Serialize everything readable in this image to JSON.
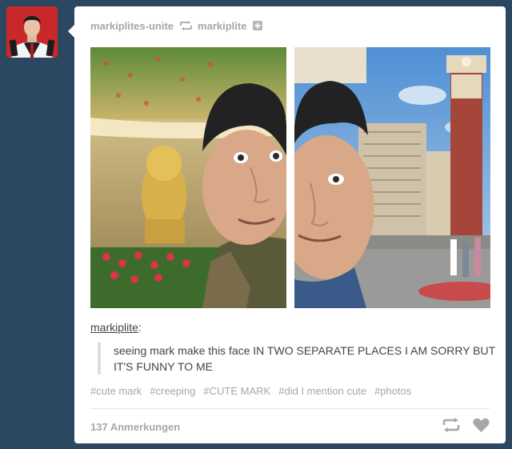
{
  "post": {
    "author": "markiplites-unite",
    "reblogged_from": "markiplite",
    "source_user": "markiplite",
    "source_suffix": ":",
    "quote_text": "seeing mark make this face IN TWO SEPARATE PLACES I AM SORRY BUT IT'S FUNNY TO ME",
    "tags": [
      "#cute mark",
      "#creeping",
      "#CUTE MARK",
      "#did I mention cute",
      "#photos"
    ],
    "notes": "137 Anmerkungen"
  },
  "icons": {
    "reblog_small": "reblog-icon",
    "follow": "plus-square-icon",
    "reblog": "reblog-icon",
    "like": "heart-icon"
  },
  "colors": {
    "background": "#2c4762",
    "card": "#ffffff",
    "meta_text": "#a7a7a7",
    "body_text": "#444444",
    "avatar_bg": "#c8282a"
  }
}
